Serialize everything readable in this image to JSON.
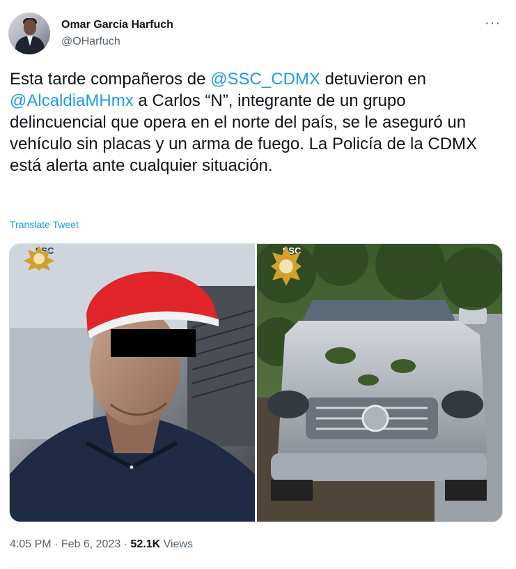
{
  "author": {
    "name": "Omar Garcia Harfuch",
    "handle": "@OHarfuch"
  },
  "more_icon": "more-horizontal-icon",
  "tweet": {
    "text_1": "Esta tarde compañeros de ",
    "mention_1": "@SSC_CDMX",
    "text_2": " detuvieron en ",
    "mention_2": "@AlcaldiaMHmx",
    "text_3": " a Carlos “N”, integrante de un grupo delincuencial que opera en el norte del país, se le aseguró un vehículo sin placas y un arma de fuego. La Policía de la CDMX está alerta ante cualquier situación."
  },
  "translate_label": "Translate Tweet",
  "media": {
    "badge_text": "SSC"
  },
  "meta": {
    "time": "4:05 PM",
    "date": "Feb 6, 2023",
    "views_count": "52.1K",
    "views_label": "Views",
    "separator": "·"
  },
  "colors": {
    "link": "#1d9bf0",
    "text": "#0f1419",
    "secondary": "#536471"
  }
}
